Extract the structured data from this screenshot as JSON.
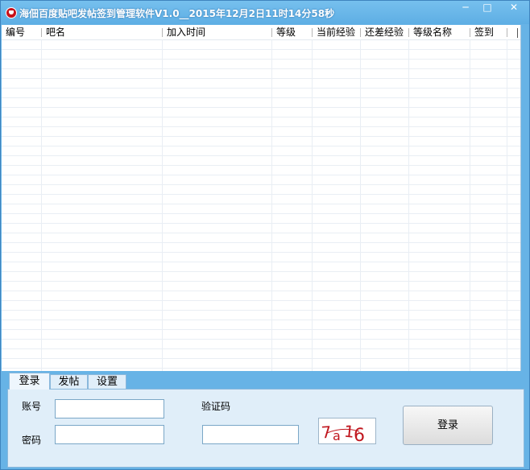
{
  "window": {
    "title": "海佃百度贴吧发帖签到管理软件V1.0__2015年12月2日11时14分58秒",
    "minimize_symbol": "─",
    "maximize_symbol": "□",
    "close_symbol": "✕"
  },
  "table": {
    "columns": [
      "编号",
      "吧名",
      "加入时间",
      "等级",
      "当前经验",
      "还差经验",
      "等级名称",
      "签到"
    ],
    "rows": []
  },
  "tabs": [
    "登录",
    "发帖",
    "设置"
  ],
  "active_tab": "登录",
  "login": {
    "account_label": "账号",
    "password_label": "密码",
    "captcha_label": "验证码",
    "account_value": "",
    "password_value": "",
    "captcha_value": "",
    "captcha_image_text": "7a16",
    "login_button": "登录"
  },
  "colors": {
    "titlebar": "#5eaee4",
    "window_frame": "#67b3e6",
    "captcha_text": "#c0161e"
  }
}
